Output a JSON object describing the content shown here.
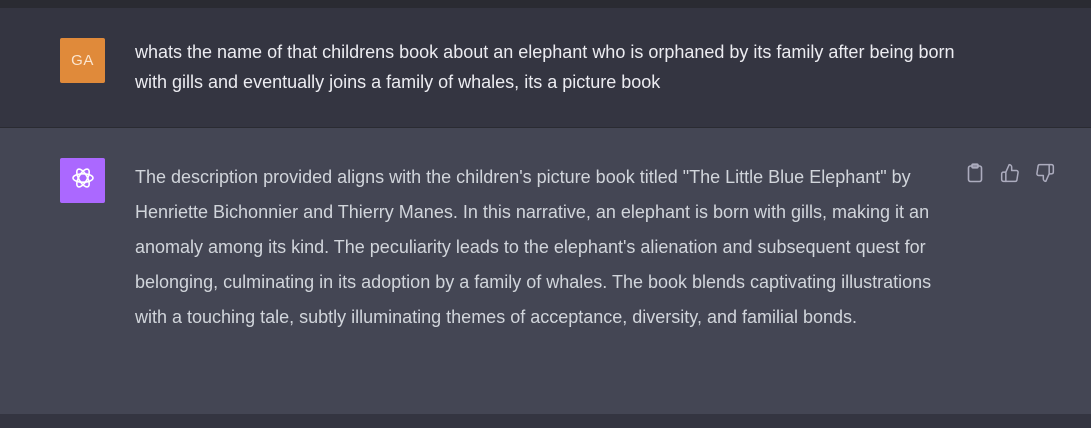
{
  "user_message": {
    "avatar_initials": "GA",
    "text": "whats the name of that childrens book about an elephant who is orphaned by its family after being born with gills and eventually joins a family of whales, its a picture book"
  },
  "assistant_message": {
    "avatar_icon": "openai-logo-icon",
    "text": "The description provided aligns with the children's picture book titled \"The Little Blue Elephant\" by Henriette Bichonnier and Thierry Manes. In this narrative, an elephant is born with gills, making it an anomaly among its kind. The peculiarity leads to the elephant's alienation and subsequent quest for belonging, culminating in its adoption by a family of whales. The book blends captivating illustrations with a touching tale, subtly illuminating themes of acceptance, diversity, and familial bonds.",
    "actions": [
      {
        "name": "copy",
        "icon": "clipboard-icon"
      },
      {
        "name": "thumbs-up",
        "icon": "thumbs-up-icon"
      },
      {
        "name": "thumbs-down",
        "icon": "thumbs-down-icon"
      }
    ]
  },
  "colors": {
    "background": "#343541",
    "assistant_background": "#444654",
    "user_avatar": "#e08a3a",
    "assistant_avatar": "#ab68ff",
    "user_text": "#ececf1",
    "assistant_text": "#d1d5db"
  }
}
